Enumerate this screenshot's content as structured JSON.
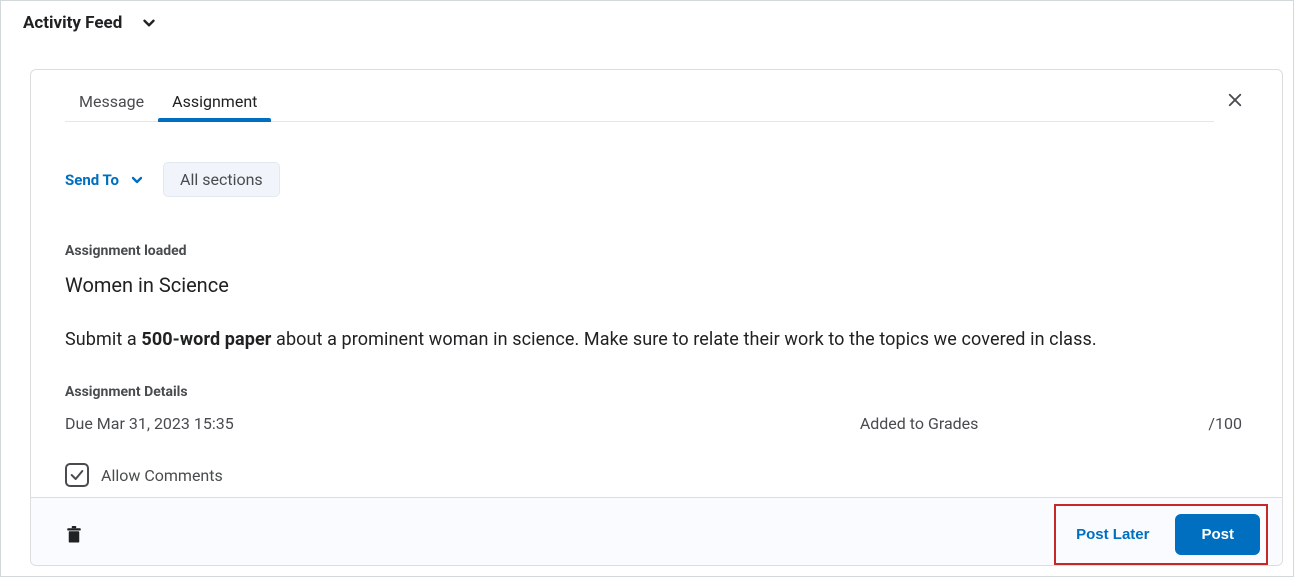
{
  "header": {
    "title": "Activity Feed"
  },
  "tabs": {
    "message": "Message",
    "assignment": "Assignment"
  },
  "sendto": {
    "label": "Send To",
    "chip": "All sections"
  },
  "assignment": {
    "loaded_label": "Assignment loaded",
    "title": "Women in Science",
    "desc_prefix": "Submit a ",
    "desc_bold": "500-word paper",
    "desc_suffix": " about a prominent woman in science. Make sure to relate their work to the topics we covered in class.",
    "details_label": "Assignment Details",
    "due": "Due Mar 31, 2023 15:35",
    "grades": "Added to Grades",
    "score": "/100"
  },
  "allow": {
    "label": "Allow Comments",
    "checked": true
  },
  "footer": {
    "post_later": "Post Later",
    "post": "Post"
  }
}
